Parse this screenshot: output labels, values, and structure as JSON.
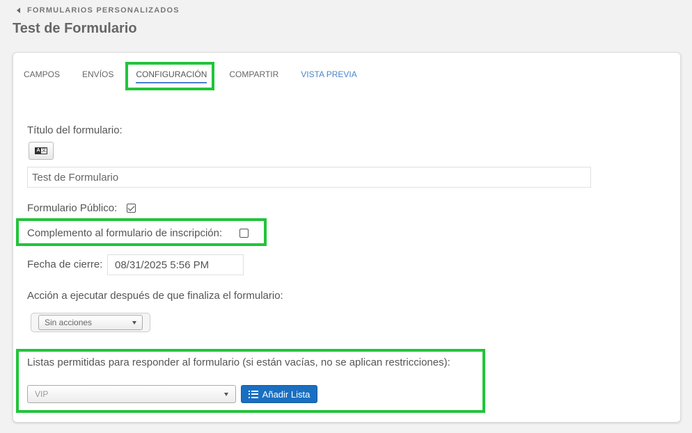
{
  "header": {
    "breadcrumb": "FORMULARIOS PERSONALIZADOS",
    "title": "Test de Formulario"
  },
  "tabs": [
    {
      "label": "CAMPOS"
    },
    {
      "label": "ENVÍOS"
    },
    {
      "label": "CONFIGURACIÓN"
    },
    {
      "label": "COMPARTIR"
    },
    {
      "label": "VISTA PREVIA"
    }
  ],
  "form": {
    "title_label": "Título del formulario:",
    "title_value": "Test de Formulario",
    "public_label": "Formulario Público:",
    "public_checked": true,
    "complement_label": "Complemento al formulario de inscripción:",
    "complement_checked": false,
    "close_date_label": "Fecha de cierre:",
    "close_date_value": "08/31/2025 5:56 PM",
    "action_label": "Acción a ejecutar después de que finaliza el formulario:",
    "action_selected": "Sin acciones",
    "lists_label": "Listas permitidas para responder al formulario (si están vacías, no se aplican restricciones):",
    "lists_selected": "VIP",
    "add_list_button": "Añadir Lista"
  },
  "colors": {
    "highlight": "#22c43a",
    "accent": "#1a6fc1",
    "link": "#4a86c8"
  }
}
